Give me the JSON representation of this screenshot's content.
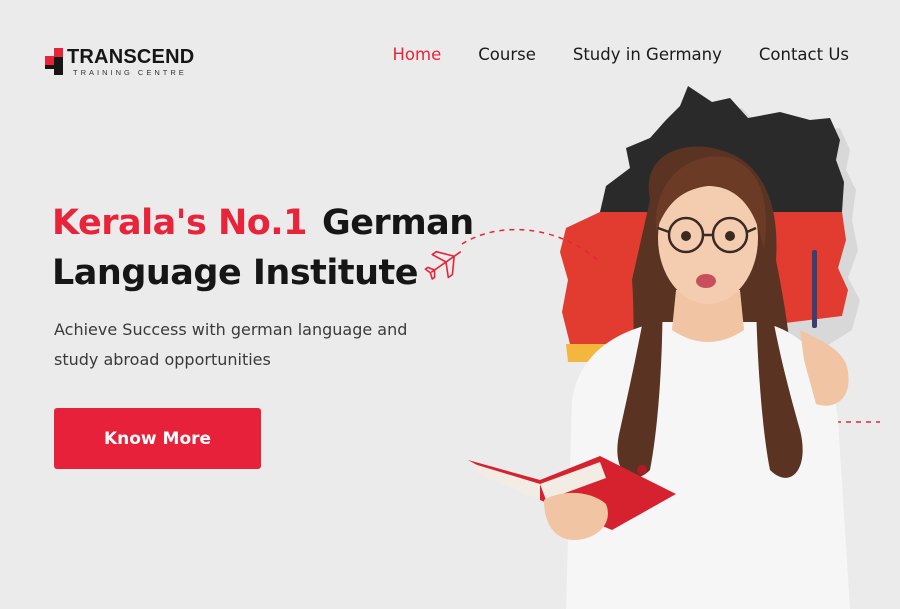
{
  "brand": {
    "name": "TRANSCEND",
    "tagline": "TRAINING CENTRE",
    "accent_color": "#e8243a"
  },
  "nav": {
    "items": [
      {
        "label": "Home",
        "active": true
      },
      {
        "label": "Course",
        "active": false
      },
      {
        "label": "Study in Germany",
        "active": false
      },
      {
        "label": "Contact Us",
        "active": false
      }
    ]
  },
  "hero": {
    "headline_accent": "Kerala's No.1",
    "headline_rest": "German",
    "headline_line2": "Language Institute",
    "subtext": "Achieve Success with german language and study abroad opportunities",
    "cta_label": "Know More"
  },
  "illustration": {
    "map_flag_colors": [
      "#2a2a2a",
      "#e23b30",
      "#f4b63d"
    ],
    "icons": [
      "airplane-icon"
    ]
  }
}
